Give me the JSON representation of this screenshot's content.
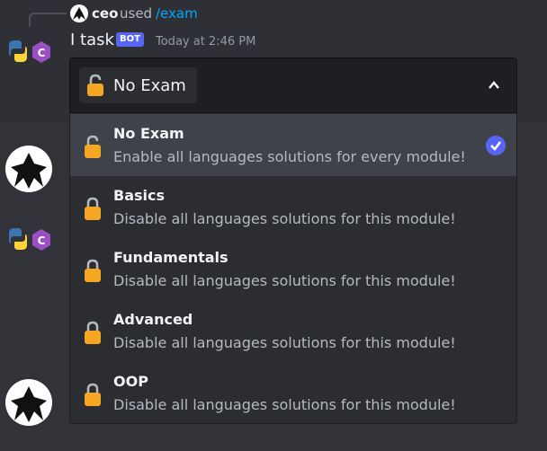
{
  "reply": {
    "user": "ceo",
    "used": "used",
    "command": "/exam"
  },
  "message": {
    "author": "I task",
    "badge": "BOT",
    "timestamp": "Today at 2:46 PM"
  },
  "select": {
    "selected_label": "No Exam"
  },
  "options": [
    {
      "title": "No Exam",
      "description": "Enable all languages solutions for every module!",
      "selected": true
    },
    {
      "title": "Basics",
      "description": "Disable all languages solutions for this module!",
      "selected": false
    },
    {
      "title": "Fundamentals",
      "description": "Disable all languages solutions for this module!",
      "selected": false
    },
    {
      "title": "Advanced",
      "description": "Disable all languages solutions for this module!",
      "selected": false
    },
    {
      "title": "OOP",
      "description": "Disable all languages solutions for this module!",
      "selected": false
    }
  ],
  "colors": {
    "accent": "#5865f2",
    "link": "#00a8fc",
    "lock": "#f5a623"
  },
  "icons": {
    "unlocked": "unlock-icon",
    "locked": "lock-icon",
    "check": "check-icon",
    "chevron": "chevron-up-icon"
  }
}
